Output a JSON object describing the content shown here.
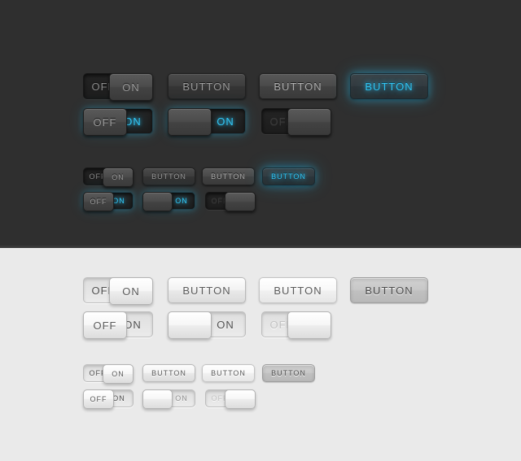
{
  "theme": {
    "dark_bg": "#2f2f2f",
    "light_bg": "#eaeaea",
    "accent_cyan": "#31c6f5"
  },
  "labels": {
    "off": "OFF",
    "on": "ON",
    "button": "BUTTON"
  },
  "dark_section": {
    "row1": [
      {
        "type": "toggle",
        "name": "toggle-off-default",
        "off": "OFF",
        "on": "ON",
        "knob_side": "right",
        "knob_text": "ON",
        "state": "off"
      },
      {
        "type": "button",
        "name": "button-normal",
        "label": "BUTTON",
        "state": "normal"
      },
      {
        "type": "button",
        "name": "button-hover",
        "label": "BUTTON",
        "state": "hover"
      },
      {
        "type": "button",
        "name": "button-active",
        "label": "BUTTON",
        "state": "active"
      }
    ],
    "row2": [
      {
        "type": "toggle",
        "name": "toggle-on-glow",
        "off": "OFF",
        "on": "ON",
        "knob_side": "left",
        "knob_text": "OFF",
        "state": "on"
      },
      {
        "type": "toggle",
        "name": "toggle-on-knob-left",
        "off": "",
        "on": "ON",
        "knob_side": "left",
        "knob_text": "",
        "state": "on"
      },
      {
        "type": "toggle",
        "name": "toggle-off-dim",
        "off": "OFF",
        "on": "",
        "knob_side": "right",
        "knob_text": "",
        "state": "off-dim"
      }
    ],
    "row3": [
      {
        "type": "toggle",
        "name": "toggle-small-off-default",
        "off": "OFF",
        "on": "ON",
        "knob_side": "right",
        "knob_text": "ON",
        "state": "off"
      },
      {
        "type": "button",
        "name": "button-small-normal",
        "label": "BUTTON",
        "state": "normal"
      },
      {
        "type": "button",
        "name": "button-small-hover",
        "label": "BUTTON",
        "state": "hover"
      },
      {
        "type": "button",
        "name": "button-small-active",
        "label": "BUTTON",
        "state": "active"
      }
    ],
    "row4": [
      {
        "type": "toggle",
        "name": "toggle-small-on-glow",
        "off": "OFF",
        "on": "ON",
        "knob_side": "left",
        "knob_text": "OFF",
        "state": "on"
      },
      {
        "type": "toggle",
        "name": "toggle-small-on-knob-left",
        "off": "",
        "on": "ON",
        "knob_side": "left",
        "knob_text": "",
        "state": "on"
      },
      {
        "type": "toggle",
        "name": "toggle-small-off-dim",
        "off": "OFF",
        "on": "",
        "knob_side": "right",
        "knob_text": "",
        "state": "off-dim"
      }
    ]
  },
  "light_section": {
    "row1": [
      {
        "type": "toggle",
        "name": "light-toggle-off-default",
        "off": "OFF",
        "on": "ON",
        "knob_side": "right",
        "knob_text": "ON",
        "state": "off"
      },
      {
        "type": "button",
        "name": "light-button-normal",
        "label": "BUTTON",
        "state": "normal"
      },
      {
        "type": "button",
        "name": "light-button-hover",
        "label": "BUTTON",
        "state": "hover"
      },
      {
        "type": "button",
        "name": "light-button-active",
        "label": "BUTTON",
        "state": "active"
      }
    ],
    "row2": [
      {
        "type": "toggle",
        "name": "light-toggle-on",
        "off": "OFF",
        "on": "ON",
        "knob_side": "left",
        "knob_text": "OFF",
        "state": "on"
      },
      {
        "type": "toggle",
        "name": "light-toggle-on-knob-left",
        "off": "",
        "on": "ON",
        "knob_side": "left",
        "knob_text": "",
        "state": "on"
      },
      {
        "type": "toggle",
        "name": "light-toggle-off-dim",
        "off": "OFF",
        "on": "",
        "knob_side": "right",
        "knob_text": "",
        "state": "off-dim"
      }
    ],
    "row3": [
      {
        "type": "toggle",
        "name": "light-toggle-small-off-default",
        "off": "OFF",
        "on": "ON",
        "knob_side": "right",
        "knob_text": "ON",
        "state": "off"
      },
      {
        "type": "button",
        "name": "light-button-small-normal",
        "label": "BUTTON",
        "state": "normal"
      },
      {
        "type": "button",
        "name": "light-button-small-hover",
        "label": "BUTTON",
        "state": "hover"
      },
      {
        "type": "button",
        "name": "light-button-small-active",
        "label": "BUTTON",
        "state": "active"
      }
    ],
    "row4": [
      {
        "type": "toggle",
        "name": "light-toggle-small-on",
        "off": "OFF",
        "on": "ON",
        "knob_side": "left",
        "knob_text": "OFF",
        "state": "on"
      },
      {
        "type": "toggle",
        "name": "light-toggle-small-on-knob-left",
        "off": "",
        "on": "ON",
        "knob_side": "left",
        "knob_text": "",
        "state": "on"
      },
      {
        "type": "toggle",
        "name": "light-toggle-small-off-dim",
        "off": "OFF",
        "on": "",
        "knob_side": "right",
        "knob_text": "",
        "state": "off-dim"
      }
    ]
  }
}
